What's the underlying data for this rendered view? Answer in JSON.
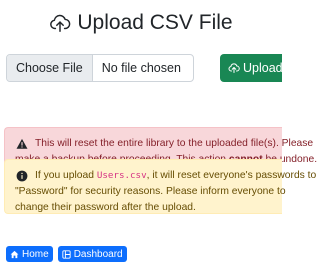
{
  "page": {
    "title": "Upload CSV File"
  },
  "form": {
    "choose_file_label": "Choose File",
    "file_status": "No file chosen",
    "upload_label": "Upload"
  },
  "alerts": {
    "danger": {
      "line1": "This will reset the entire library to the uploaded file(s). Please",
      "line2_pre": "make a backup before proceeding. This action ",
      "line2_bold": "cannot",
      "line2_post": " be undone."
    },
    "warning": {
      "line1_pre": "If you upload ",
      "line1_code": "Users.csv",
      "line1_post": ", it will reset everyone's passwords to",
      "line2": "\"Password\" for security reasons. Please inform everyone to",
      "line3": "change their password after the upload."
    }
  },
  "nav": {
    "home_label": "Home",
    "dashboard_label": "Dashboard"
  },
  "colors": {
    "success": "#198754",
    "primary": "#0d6efd",
    "danger_bg": "#f8d7da",
    "warning_bg": "#fff3cd"
  },
  "icons": {
    "title": "cloud-upload-icon",
    "upload": "cloud-upload-icon",
    "danger": "warning-triangle-icon",
    "warning": "info-circle-icon",
    "home": "house-icon",
    "dashboard": "dashboard-icon"
  }
}
